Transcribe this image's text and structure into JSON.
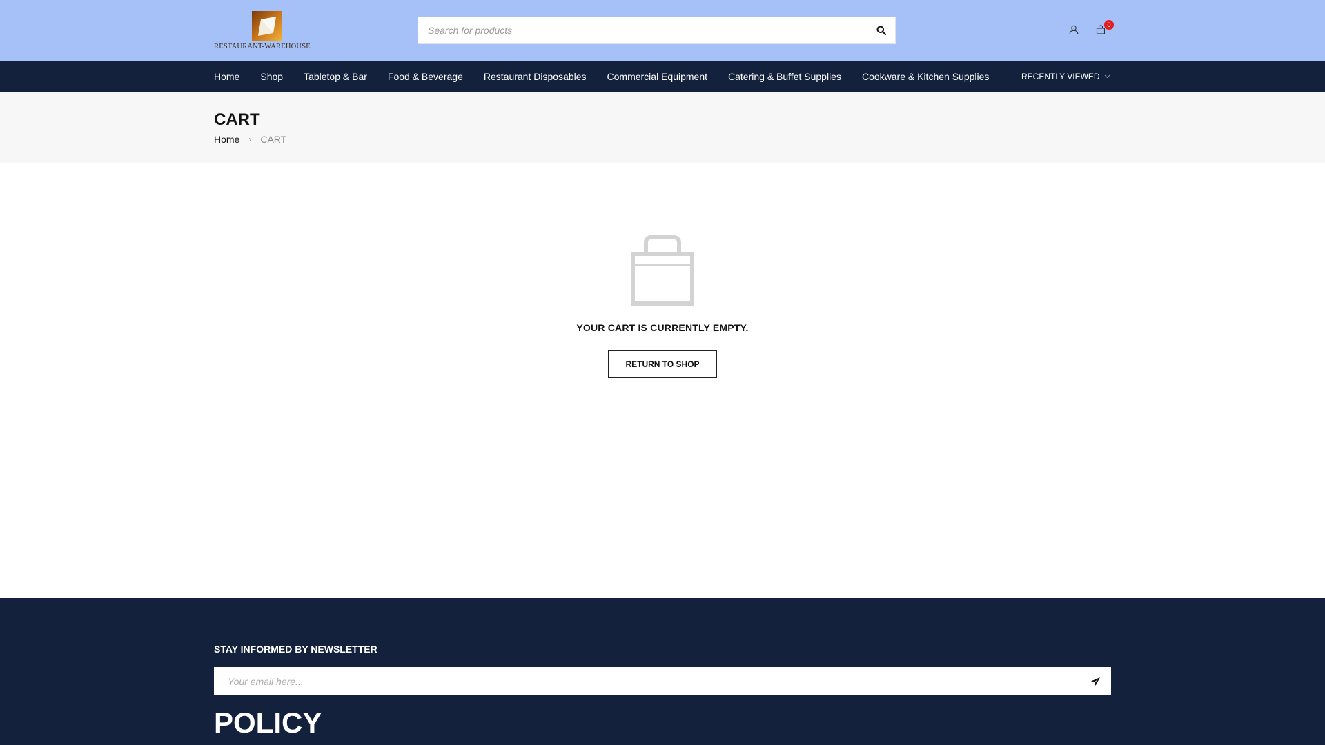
{
  "header": {
    "logo_text": "RESTAURANT-WAREHOUSE",
    "search_placeholder": "Search for products",
    "search_icon": "search-icon",
    "account_icon": "user-icon",
    "cart_icon": "shopping-bag-icon",
    "cart_count": "0",
    "bg_color": "#a5c1f7"
  },
  "nav": {
    "items": [
      "Home",
      "Shop",
      "Tabletop & Bar",
      "Food & Beverage",
      "Restaurant Disposables",
      "Commercial Equipment",
      "Catering & Buffet Supplies",
      "Cookware & Kitchen Supplies"
    ],
    "recently_viewed": "RECENTLY VIEWED",
    "bg_color": "#13213c"
  },
  "page": {
    "title": "CART",
    "breadcrumb": {
      "home": "Home",
      "separator": "›",
      "current": "CART"
    }
  },
  "cart": {
    "empty_icon": "empty-bag-icon",
    "empty_message": "YOUR CART IS CURRENTLY EMPTY.",
    "return_button": "RETURN TO SHOP"
  },
  "footer": {
    "newsletter_title": "STAY INFORMED BY NEWSLETTER",
    "email_placeholder": "Your email here...",
    "send_icon": "paper-plane-icon",
    "policy_heading": "POLICY"
  }
}
